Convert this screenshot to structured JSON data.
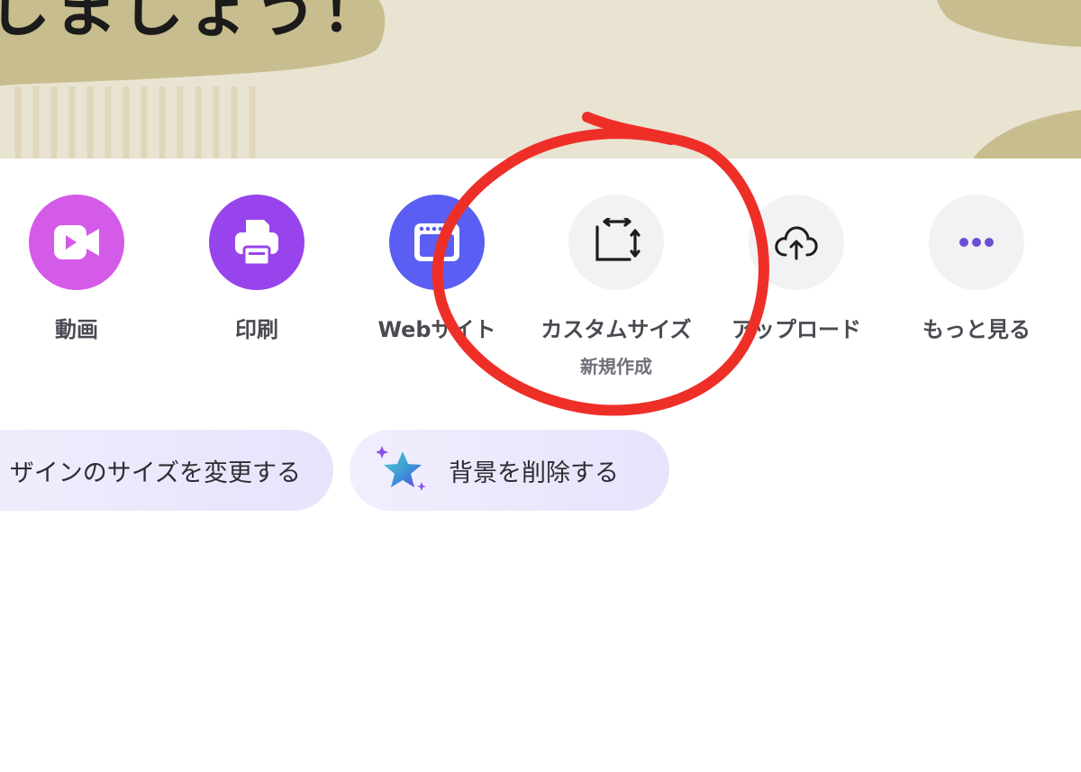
{
  "banner": {
    "title": "しましょう！"
  },
  "quick_create": {
    "items": [
      {
        "key": "video",
        "label": "動画",
        "icon": "video-camera-icon",
        "color": "#d45ae8"
      },
      {
        "key": "print",
        "label": "印刷",
        "icon": "printer-icon",
        "color": "#9844ec"
      },
      {
        "key": "website",
        "label": "Webサイト",
        "icon": "browser-window-icon",
        "color": "#5a5ef2"
      },
      {
        "key": "custom-size",
        "label": "カスタムサイズ",
        "sublabel": "新規作成",
        "icon": "resize-icon",
        "color": "#f2f2f4"
      },
      {
        "key": "upload",
        "label": "アップロード",
        "icon": "cloud-upload-icon",
        "color": "#f2f2f4"
      },
      {
        "key": "more",
        "label": "もっと見る",
        "icon": "more-dots-icon",
        "color": "#f2f2f4"
      }
    ]
  },
  "magic_actions": [
    {
      "label": "デザインのサイズを変更する",
      "visible_label": "ザインのサイズを変更する"
    },
    {
      "label": "背景を削除する",
      "icon": "sparkle-star-icon"
    }
  ],
  "annotation": {
    "color": "#ee2f28",
    "shape": "hand-drawn circle around custom size"
  }
}
